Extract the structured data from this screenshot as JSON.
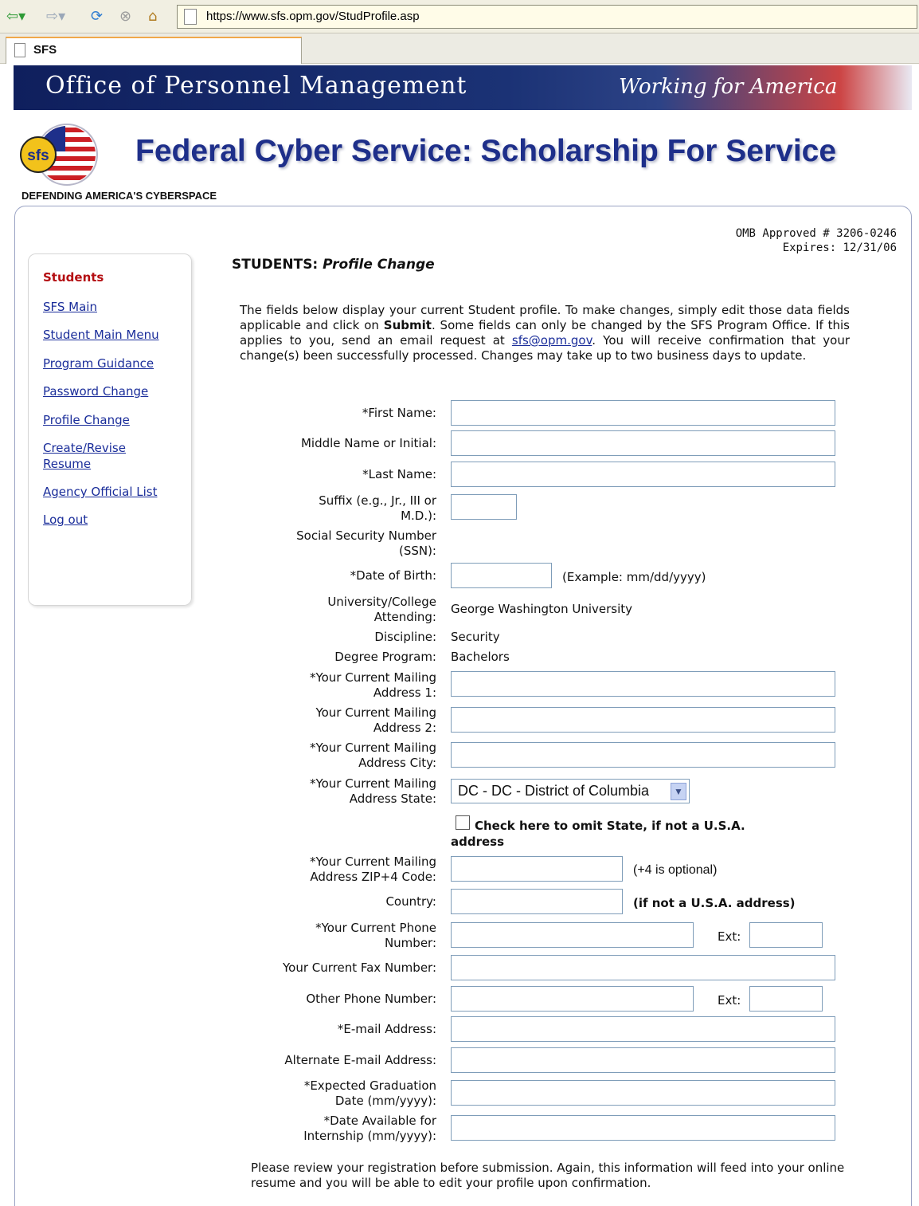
{
  "browser": {
    "url": "https://www.sfs.opm.gov/StudProfile.asp",
    "tab_title": "SFS",
    "icons": [
      "back-arrow-icon",
      "forward-arrow-icon",
      "refresh-icon",
      "stop-icon",
      "home-icon",
      "page-icon"
    ]
  },
  "banner": {
    "org": "Office of Personnel Management",
    "tagline": "Working for America"
  },
  "header": {
    "logo_text": "sfs",
    "title": "Federal Cyber Service: Scholarship For Service",
    "slogan": "DEFENDING AMERICA'S CYBERSPACE"
  },
  "omb": {
    "line1": "OMB Approved # 3206-0246",
    "line2": "Expires: 12/31/06"
  },
  "sidebar": {
    "heading": "Students",
    "links": [
      {
        "label": "SFS Main"
      },
      {
        "label": "Student Main Menu"
      },
      {
        "label": "Program Guidance"
      },
      {
        "label": "Password Change"
      },
      {
        "label": "Profile Change"
      },
      {
        "label": "Create/Revise Resume"
      },
      {
        "label": "Agency Official List"
      },
      {
        "label": "Log out"
      }
    ]
  },
  "page": {
    "section": "STUDENTS:",
    "subtitle": "Profile Change",
    "intro_1": "The fields below display your current Student profile. To make changes, simply edit those data fields applicable and click on ",
    "intro_bold": "Submit",
    "intro_2": ". Some fields can only be changed by the SFS Program Office. If this applies to you, send an email request at ",
    "intro_email": "sfs@opm.gov",
    "intro_3": ". You will receive confirmation that your change(s) been successfully processed. Changes may take up to two business days to update."
  },
  "form": {
    "first_name": {
      "label": "*First Name:",
      "value": ""
    },
    "middle_name": {
      "label": "Middle Name or Initial:",
      "value": ""
    },
    "last_name": {
      "label": "*Last Name:",
      "value": ""
    },
    "suffix": {
      "label_1": "Suffix (e.g., Jr., III or",
      "label_2": "M.D.):",
      "value": ""
    },
    "ssn": {
      "label_1": "Social Security Number",
      "label_2": "(SSN):"
    },
    "dob": {
      "label": "*Date of Birth:",
      "value": "",
      "hint": "(Example: mm/dd/yyyy)"
    },
    "university": {
      "label_1": "University/College",
      "label_2": "Attending:",
      "value": "George Washington University"
    },
    "discipline": {
      "label": "Discipline:",
      "value": "Security"
    },
    "degree": {
      "label": "Degree Program:",
      "value": "Bachelors"
    },
    "address1": {
      "label_1": "*Your Current Mailing",
      "label_2": "Address 1:",
      "value": ""
    },
    "address2": {
      "label_1": "Your Current Mailing",
      "label_2": "Address 2:",
      "value": ""
    },
    "city": {
      "label_1": "*Your Current Mailing",
      "label_2": "Address City:",
      "value": ""
    },
    "state": {
      "label_1": "*Your Current Mailing",
      "label_2": "Address State:",
      "selected": "DC - DC - District of Columbia"
    },
    "omit_state": {
      "label": "Check here to omit State, if not a U.S.A. address",
      "checked": false
    },
    "zip": {
      "label_1": "*Your Current Mailing",
      "label_2": "Address ZIP+4 Code:",
      "value": "",
      "hint": "(+4 is optional)"
    },
    "country": {
      "label": "Country:",
      "value": "",
      "hint": "(if not a U.S.A. address)"
    },
    "phone": {
      "label_1": "*Your Current Phone",
      "label_2": "Number:",
      "value": "",
      "ext_label": "Ext:",
      "ext_value": ""
    },
    "fax": {
      "label": "Your Current Fax Number:",
      "value": ""
    },
    "other_phone": {
      "label": "Other Phone Number:",
      "value": "",
      "ext_label": "Ext:",
      "ext_value": ""
    },
    "email": {
      "label": "*E-mail Address:",
      "value": ""
    },
    "alt_email": {
      "label": "Alternate E-mail Address:",
      "value": ""
    },
    "grad_date": {
      "label_1": "*Expected Graduation",
      "label_2": "Date (mm/yyyy):",
      "value": ""
    },
    "internship_date": {
      "label_1": "*Date Available for",
      "label_2": "Internship (mm/yyyy):",
      "value": ""
    }
  },
  "footer": {
    "review": "Please review your registration before submission. Again, this information will feed into your online resume and you will be able to edit your profile upon confirmation."
  },
  "colors": {
    "link": "#1a2d9a",
    "heading_red": "#b40e12",
    "title_blue": "#1e2f8a",
    "banner_navy": "#0f1f5d"
  }
}
